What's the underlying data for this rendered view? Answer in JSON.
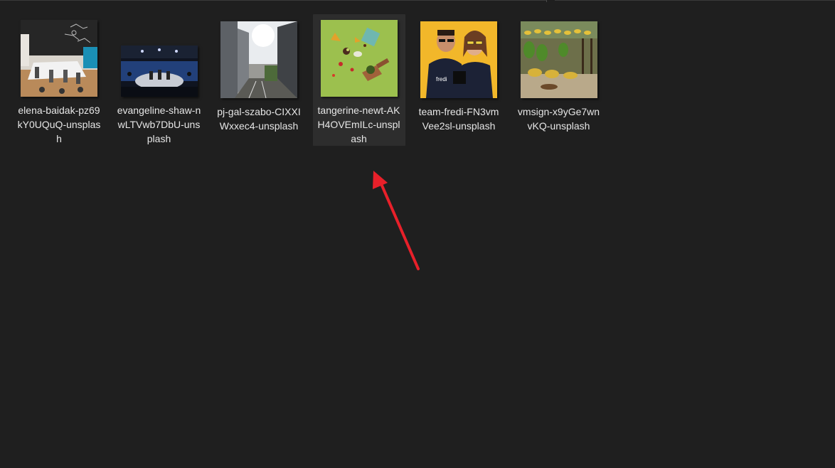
{
  "files": [
    {
      "label": "elena-baidak-pz69kY0UQuQ-unsplash",
      "thumbnail": "office-meeting-room-photo",
      "selected": false
    },
    {
      "label": "evangeline-shaw-nwLTVwb7DbU-unsplash",
      "thumbnail": "conference-stage-photo",
      "selected": false
    },
    {
      "label": "pj-gal-szabo-CIXXIWxxec4-unsplash",
      "thumbnail": "city-walkway-photo",
      "selected": false
    },
    {
      "label": "tangerine-newt-AKH4OVEmILc-unsplash",
      "thumbnail": "floating-food-green-photo",
      "selected": true
    },
    {
      "label": "team-fredi-FN3vmVee2sl-unsplash",
      "thumbnail": "couple-yellow-background-photo",
      "selected": false
    },
    {
      "label": "vmsign-x9yGe7wnvKQ-unsplash",
      "thumbnail": "banana-market-photo",
      "selected": false
    }
  ],
  "colors": {
    "background": "#1f1f1f",
    "selection": "#2d2d2d",
    "label_text": "#e6e6e6",
    "annotation_arrow": "#e8202a"
  }
}
